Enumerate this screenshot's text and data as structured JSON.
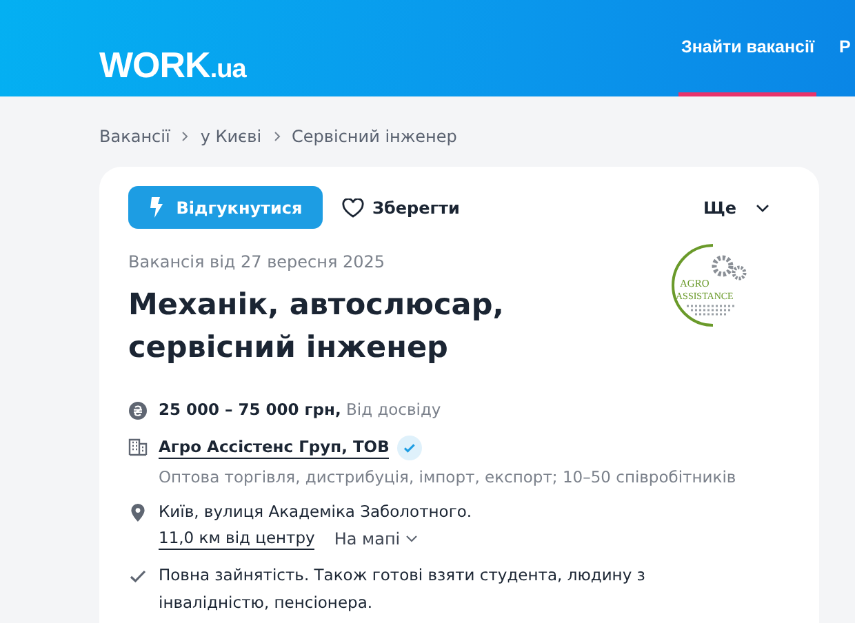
{
  "header": {
    "logo": {
      "main": "WORK",
      "suffix": ".ua"
    },
    "nav": [
      {
        "label": "Знайти вакансії",
        "selected": true
      },
      {
        "label": "Р",
        "selected": false
      }
    ]
  },
  "breadcrumbs": [
    "Вакансії",
    "у Києві",
    "Сервісний інженер"
  ],
  "actions": {
    "apply": "Відгукнутися",
    "save": "Зберегти",
    "more": "Ще"
  },
  "vacancy": {
    "date": "Вакансія від 27 вересня 2025",
    "title": "Механік, автослюсар, сервісний інженер",
    "company_logo": {
      "line1": "AGRO",
      "line2": "ASSISTANCE"
    }
  },
  "details": [
    {
      "kind": "salary",
      "amount": "25 000 – 75 000 грн,",
      "note": "Від досвіду"
    },
    {
      "kind": "company",
      "name": "Агро Ассістенс Груп, ТОВ",
      "verified": true,
      "description": "Оптова торгівля, дистрибуція, імпорт, експорт; 10–50 співробітників"
    },
    {
      "kind": "location",
      "address": "Київ, вулиця Академіка Заболотного.",
      "distance": "11,0 км від центру",
      "map_link": "На мапі"
    },
    {
      "kind": "employment",
      "text": "Повна зайнятість. Також готові взяти студента, людину з інвалідністю, пенсіонера."
    }
  ]
}
